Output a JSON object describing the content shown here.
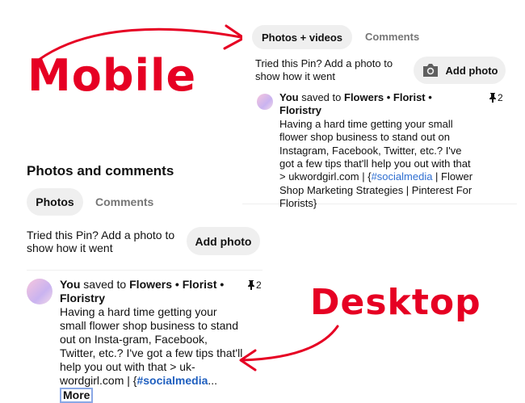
{
  "annotations": {
    "mobile_label": "Mobile",
    "desktop_label": "Desktop"
  },
  "mobile": {
    "tabs": [
      {
        "label": "Photos + videos",
        "active": true
      },
      {
        "label": "Comments",
        "active": false
      }
    ],
    "prompt": "Tried this Pin? Add a photo to show how it went",
    "add_photo_label": "Add photo",
    "feed": {
      "you": "You",
      "saved_to": "saved to",
      "board": "Flowers • Florist • Floristry",
      "pin_count": "2",
      "text_before_tag": "Having a hard time getting your small flower shop business to stand out on Instagram, Facebook, Twitter, etc.? I've got a few tips that'll help you out with that > ukwordgirl.com | {",
      "tag": "#socialmedia",
      "text_after_tag": " | Flower Shop Marketing Strategies | Pinterest For Florists}"
    }
  },
  "desktop": {
    "section_title": "Photos and comments",
    "tabs": [
      {
        "label": "Photos",
        "active": true
      },
      {
        "label": "Comments",
        "active": false
      }
    ],
    "prompt": "Tried this Pin? Add a photo to show how it went",
    "add_photo_label": "Add photo",
    "feed": {
      "you": "You",
      "saved_to": "saved to",
      "board": "Flowers • Florist • Floristry",
      "pin_count": "2",
      "text": "Having a hard time getting your small flower shop business to stand out on Insta-gram, Facebook, Twitter, etc.? I've got a few tips that'll help you out with that > uk-wordgirl.com | {",
      "tag": "#socialmedia",
      "ellipsis": "...",
      "more_label": "More"
    }
  },
  "colors": {
    "annotation_red": "#e60023",
    "pill_gray": "#efefef",
    "link_blue": "#2f6fd1"
  }
}
